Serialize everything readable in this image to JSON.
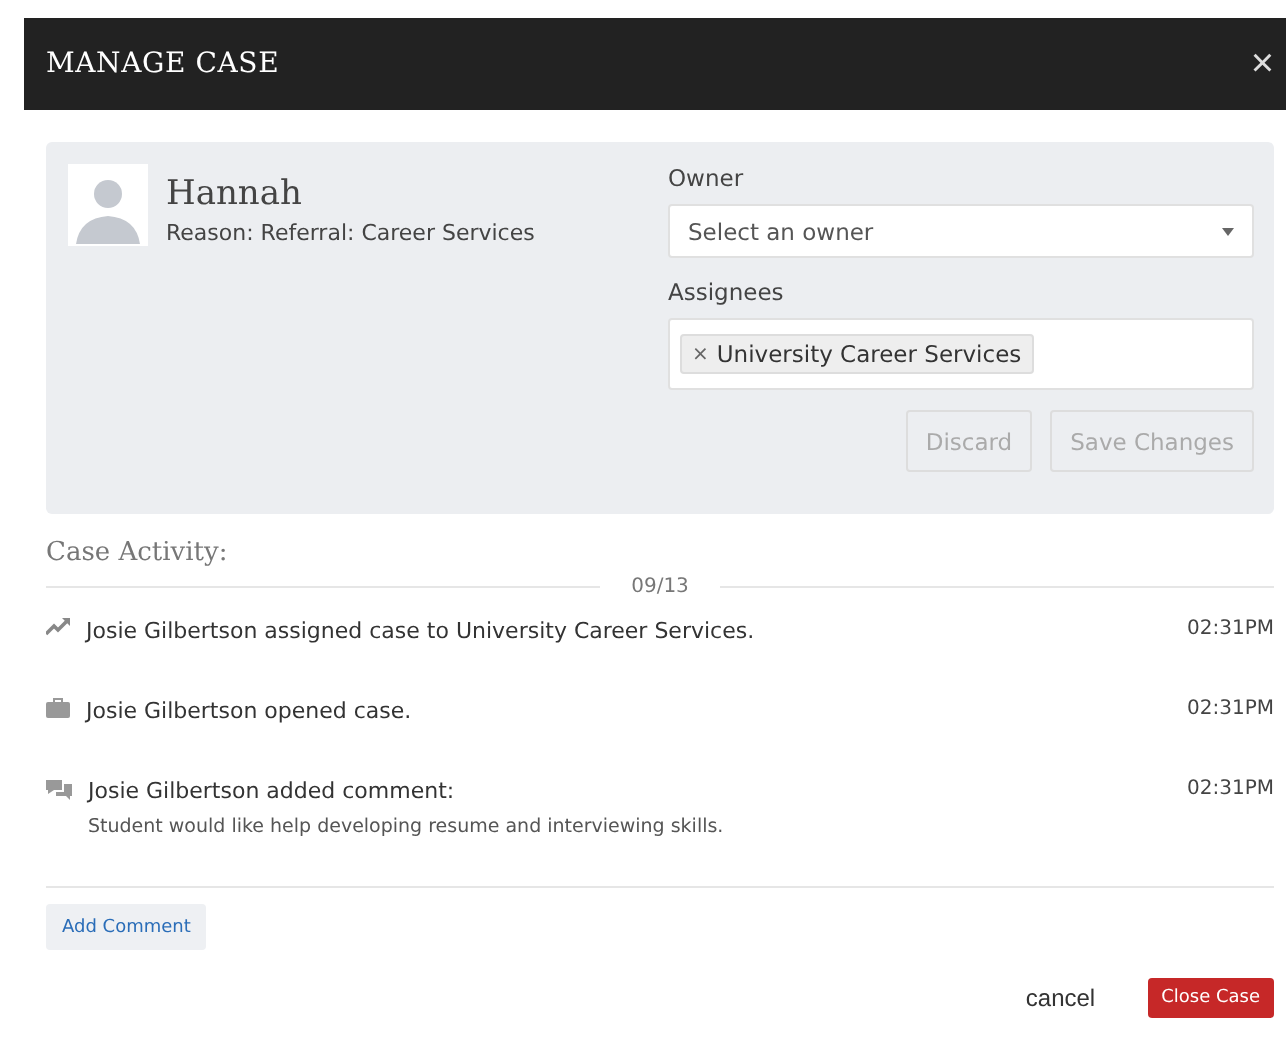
{
  "modal": {
    "title": "MANAGE CASE",
    "close": "×"
  },
  "student": {
    "name": "Hannah",
    "reason": "Reason: Referral: Career Services"
  },
  "owner": {
    "label": "Owner",
    "placeholder": "Select an owner"
  },
  "assignees": {
    "label": "Assignees",
    "tags": [
      {
        "remove": "×",
        "label": "University Career Services"
      }
    ]
  },
  "form_buttons": [
    {
      "label": "Discard",
      "disabled": true
    },
    {
      "label": "Save Changes",
      "disabled": true
    }
  ],
  "activity": {
    "title": "Case Activity:",
    "date": "09/13",
    "items": [
      {
        "kind": "assigned",
        "text": "Josie Gilbertson assigned case to University Career Services.",
        "time": "02:31PM"
      },
      {
        "kind": "opened",
        "text": "Josie Gilbertson opened case.",
        "time": "02:31PM"
      },
      {
        "kind": "comment",
        "text": "Josie Gilbertson added comment:",
        "comment": "Student would like help developing resume and interviewing skills.",
        "time": "02:31PM"
      }
    ]
  },
  "add_comment": "Add Comment",
  "footer": {
    "cancel": "cancel",
    "close_case": "Close Case"
  }
}
